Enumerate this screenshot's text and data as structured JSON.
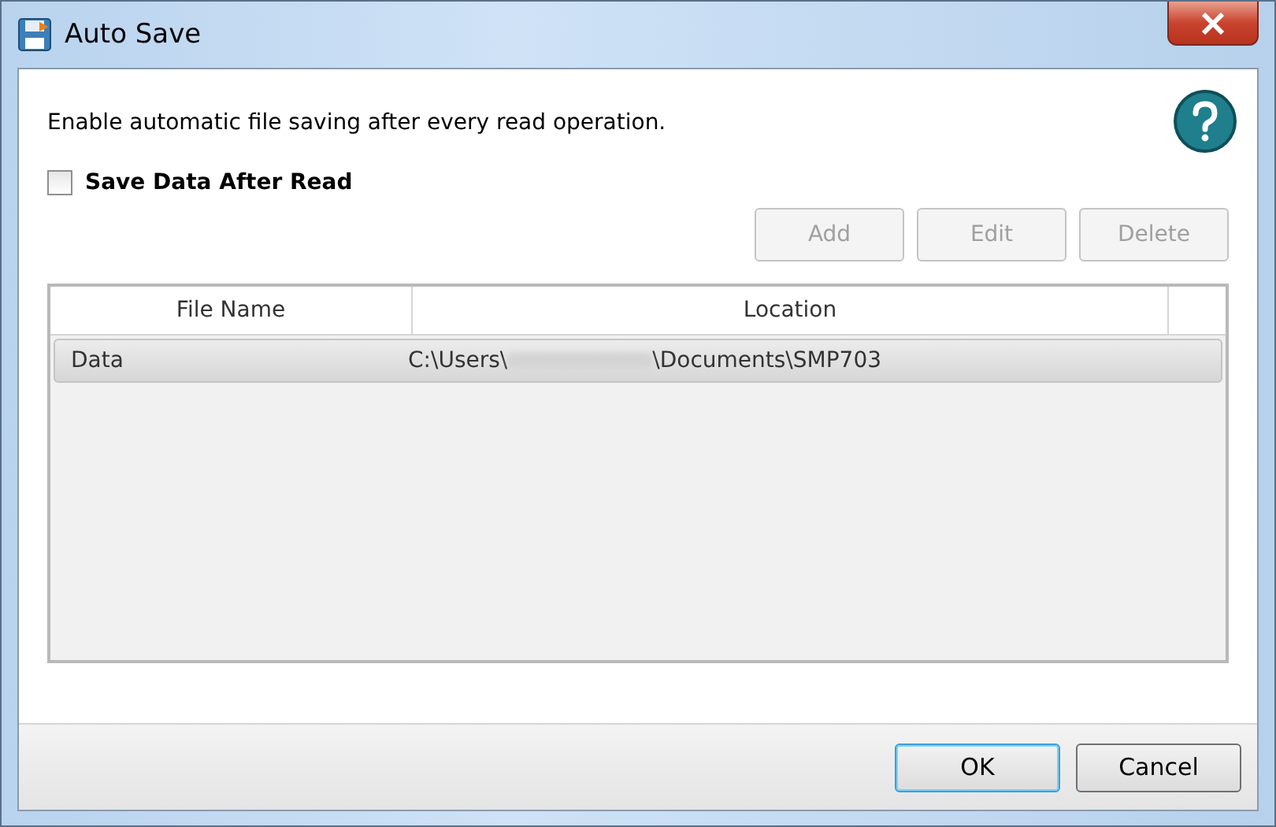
{
  "window": {
    "title": "Auto Save"
  },
  "description": "Enable automatic file saving after every read operation.",
  "save_after_read": {
    "label": "Save Data After Read",
    "checked": false
  },
  "actions": [
    {
      "label": "Add",
      "disabled": true
    },
    {
      "label": "Edit",
      "disabled": true
    },
    {
      "label": "Delete",
      "disabled": true
    }
  ],
  "table": {
    "columns": [
      "File Name",
      "Location"
    ],
    "rows": [
      {
        "file_name": "Data",
        "location_start": "C:\\Users\\",
        "location_end": "\\Documents\\SMP703",
        "selected": true
      }
    ]
  },
  "footer_buttons": [
    {
      "label": "OK",
      "default": true
    },
    {
      "label": "Cancel",
      "default": false
    }
  ]
}
